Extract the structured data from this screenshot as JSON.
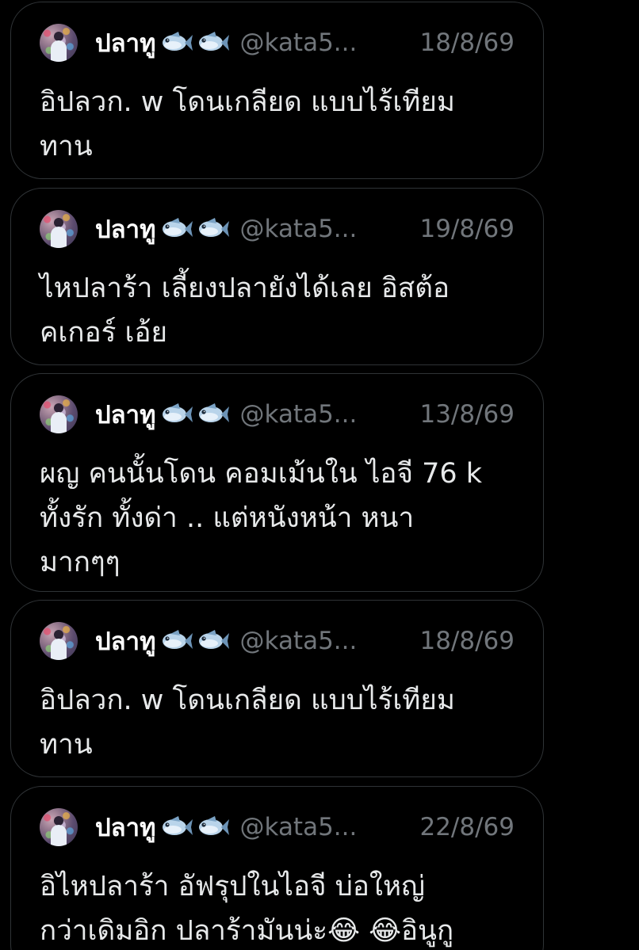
{
  "posts": [
    {
      "name": "ปลาทู",
      "handle": "@kata5...",
      "date": "18/8/69",
      "text": "อิปลวก. w โดนเกลียด แบบไร้เทียม\nทาน"
    },
    {
      "name": "ปลาทู",
      "handle": "@kata5...",
      "date": "19/8/69",
      "text": "ไหปลาร้า เลี้ยงปลายังได้เลย อิสต้อ\nคเกอร์ เอ้ย"
    },
    {
      "name": "ปลาทู",
      "handle": "@kata5...",
      "date": "13/8/69",
      "text": "ผญ คนนั้นโดน คอมเม้นใน ไอจี 76 k\nทั้งรัก ทั้งด่า .. แต่หนังหน้า หนา\nมากๆๆ"
    },
    {
      "name": "ปลาทู",
      "handle": "@kata5...",
      "date": "18/8/69",
      "text": "อิปลวก. w โดนเกลียด แบบไร้เทียม\nทาน"
    },
    {
      "name": "ปลาทู",
      "handle": "@kata5...",
      "date": "22/8/69",
      "text": "อิไหปลาร้า อัฟรุปในไอจี บ่อใหญ่\nกว่าเดิมอิก ปลาร้ามันน่ะ😂 😂อินูกู"
    }
  ],
  "icons": {
    "name_suffix": [
      "fish-icon",
      "fish-icon"
    ],
    "avatar": "avatar"
  },
  "colors": {
    "background": "#000000",
    "card_border": "#2f3336",
    "primary_text": "#e7e9ea",
    "secondary_text": "#71767b"
  }
}
